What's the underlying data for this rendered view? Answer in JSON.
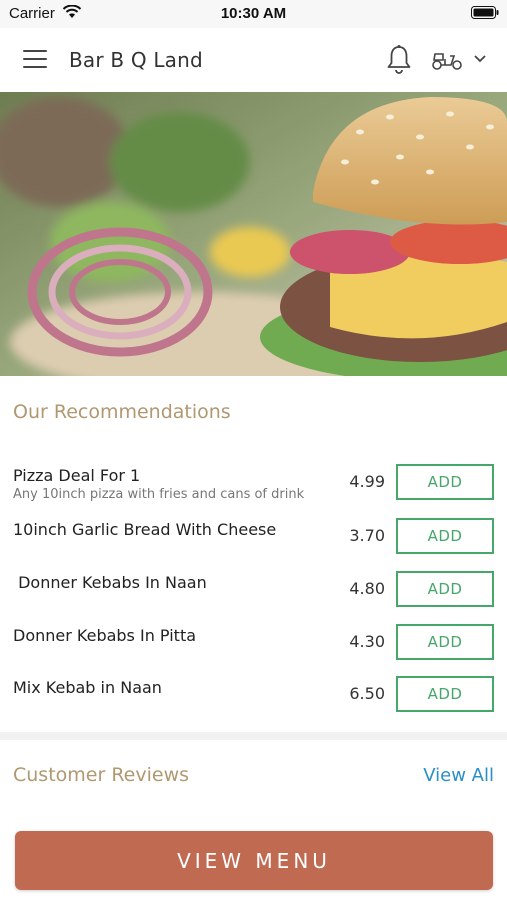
{
  "status_bar": {
    "carrier": "Carrier",
    "time": "10:30 AM"
  },
  "header": {
    "title": "Bar B Q Land",
    "icons": [
      "menu-icon",
      "bell-icon",
      "scooter-icon",
      "chevron-down-icon"
    ]
  },
  "hero": {
    "image": "burger-and-onion-photo"
  },
  "recommendations": {
    "title": "Our Recommendations",
    "items": [
      {
        "name": "Pizza Deal For 1",
        "description": "Any 10inch pizza with fries and cans of drink",
        "price": "4.99",
        "button": "ADD"
      },
      {
        "name": "10inch Garlic Bread With Cheese",
        "description": "",
        "price": "3.70",
        "button": "ADD"
      },
      {
        "name": " Donner Kebabs In Naan",
        "description": "",
        "price": "4.80",
        "button": "ADD"
      },
      {
        "name": "Donner Kebabs In Pitta",
        "description": "",
        "price": "4.30",
        "button": "ADD"
      },
      {
        "name": "Mix Kebab in Naan",
        "description": "",
        "price": "6.50",
        "button": "ADD"
      }
    ]
  },
  "reviews": {
    "title": "Customer Reviews",
    "view_all": "View All"
  },
  "footer": {
    "view_menu": "VIEW MENU"
  },
  "colors": {
    "section_title": "#b09870",
    "add_button": "#45a86a",
    "link": "#2a8fc6",
    "view_menu_button": "#c06a51"
  }
}
